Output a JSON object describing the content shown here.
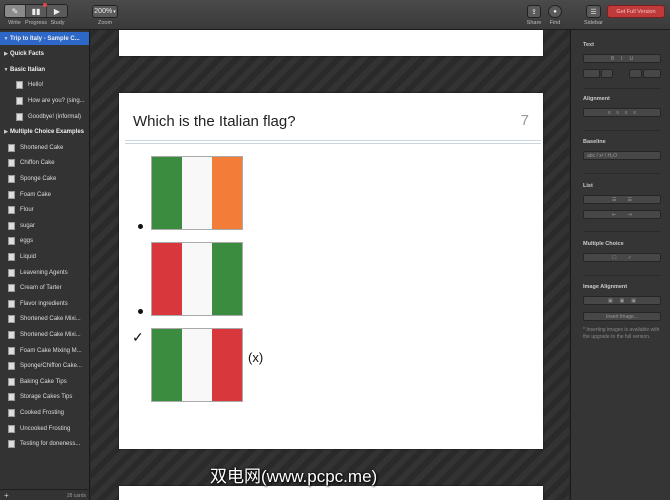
{
  "toolbar": {
    "modes": [
      {
        "icon": "pencil-icon",
        "label": "Write",
        "active": true
      },
      {
        "icon": "bar-chart-icon",
        "label": "Progress",
        "active": false
      },
      {
        "icon": "play-icon",
        "label": "Study",
        "active": false
      }
    ],
    "zoom_value": "200%",
    "zoom_label": "Zoom",
    "share_label": "Share",
    "find_label": "Find",
    "sidebar_label": "Sidebar",
    "full_version_label": "Get Full Version"
  },
  "sidebar": {
    "items": [
      {
        "label": "Trip to Italy - Sample C...",
        "kind": "group",
        "expanded": true,
        "selected": true,
        "indent": 0
      },
      {
        "label": "Quick Facts",
        "kind": "group",
        "expanded": false,
        "selected": false,
        "indent": 0
      },
      {
        "label": "Basic Italian",
        "kind": "group",
        "expanded": true,
        "selected": false,
        "indent": 0
      },
      {
        "label": "Hello!",
        "kind": "card",
        "indent": 1
      },
      {
        "label": "How are you? (sing...",
        "kind": "card",
        "indent": 1
      },
      {
        "label": "Goodbye! (informal)",
        "kind": "card",
        "indent": 1
      },
      {
        "label": "Multiple Choice Examples",
        "kind": "group",
        "expanded": false,
        "selected": false,
        "indent": 0
      },
      {
        "label": "Shortened Cake",
        "kind": "card",
        "indent": 0
      },
      {
        "label": "Chiffon Cake",
        "kind": "card",
        "indent": 0
      },
      {
        "label": "Sponge Cake",
        "kind": "card",
        "indent": 0
      },
      {
        "label": "Foam Cake",
        "kind": "card",
        "indent": 0
      },
      {
        "label": "Flour",
        "kind": "card",
        "indent": 0
      },
      {
        "label": "sugar",
        "kind": "card",
        "indent": 0
      },
      {
        "label": "eggs",
        "kind": "card",
        "indent": 0
      },
      {
        "label": "Liquid",
        "kind": "card",
        "indent": 0
      },
      {
        "label": "Leavening Agents",
        "kind": "card",
        "indent": 0
      },
      {
        "label": "Cream of Tarter",
        "kind": "card",
        "indent": 0
      },
      {
        "label": "Flavor ingredients",
        "kind": "card",
        "indent": 0
      },
      {
        "label": "Shortened Cake Mixi...",
        "kind": "card",
        "indent": 0
      },
      {
        "label": "Shortened Cake Mixi...",
        "kind": "card",
        "indent": 0
      },
      {
        "label": "Foam Cake Mixing M...",
        "kind": "card",
        "indent": 0
      },
      {
        "label": "Sponge/Chiffon Cake...",
        "kind": "card",
        "indent": 0
      },
      {
        "label": "Baking Cake Tips",
        "kind": "card",
        "indent": 0
      },
      {
        "label": "Storage Cakes Tips",
        "kind": "card",
        "indent": 0
      },
      {
        "label": "Cooked Frosting",
        "kind": "card",
        "indent": 0
      },
      {
        "label": "Uncooked Frosting",
        "kind": "card",
        "indent": 0
      },
      {
        "label": "Testing for doneness...",
        "kind": "card",
        "indent": 0
      }
    ],
    "add_label": "+",
    "card_count": "28 cards"
  },
  "card": {
    "question": "Which is the Italian flag?",
    "number": "7",
    "choices": [
      {
        "colors": [
          "#3c8c3f",
          "#f8f8f8",
          "#f27c38"
        ],
        "marker": "bullet",
        "correct": false
      },
      {
        "colors": [
          "#d8383c",
          "#f8f8f8",
          "#3c8c3f"
        ],
        "marker": "bullet",
        "correct": false
      },
      {
        "colors": [
          "#3c8c3f",
          "#f8f8f8",
          "#d8383c"
        ],
        "marker": "check",
        "correct": true
      }
    ],
    "check_glyph": "✓",
    "answer_suffix": "(x)"
  },
  "inspector": {
    "text_label": "Text",
    "alignment_label": "Alignment",
    "baseline_label": "Baseline",
    "baseline_value": "abc / x² / H₂O",
    "list_label": "List",
    "multiple_choice_label": "Multiple Choice",
    "image_alignment_label": "Image Alignment",
    "insert_image_label": "Insert Image...",
    "upgrade_note": "* Inserting images is available with the upgrade to the full version."
  },
  "watermark": "双电网(www.pcpc.me)"
}
